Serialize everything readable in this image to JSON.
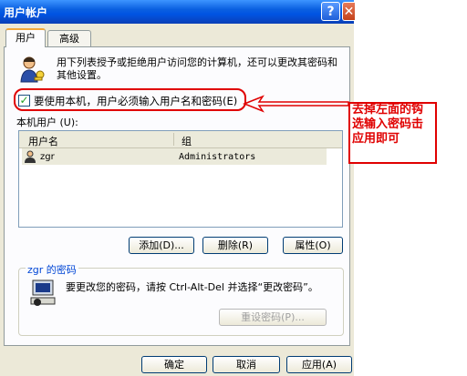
{
  "window": {
    "title": "用户帐户",
    "help_glyph": "?",
    "close_glyph": "✕"
  },
  "tabs": [
    {
      "label": "用户"
    },
    {
      "label": "高级"
    }
  ],
  "intro_text": "用下列表授予或拒绝用户访问您的计算机，还可以更改其密码和其他设置。",
  "require_checkbox": {
    "checked": true,
    "label": "要使用本机，用户必须输入用户名和密码(E)"
  },
  "local_users_label": "本机用户 (U):",
  "user_list": {
    "columns": [
      "用户名",
      "组"
    ],
    "rows": [
      {
        "name": "zgr",
        "group": "Administrators"
      }
    ]
  },
  "list_buttons": {
    "add": "添加(D)...",
    "remove": "删除(R)",
    "properties": "属性(O)"
  },
  "password_group": {
    "label": "zgr 的密码",
    "text": "要更改您的密码，请按 Ctrl-Alt-Del 并选择“更改密码”。",
    "reset_button": "重设密码(P)..."
  },
  "dialog_buttons": {
    "ok": "确定",
    "cancel": "取消",
    "apply": "应用(A)"
  },
  "annotation": {
    "text": "去掉左面的钩选输入密码击应用即可",
    "color": "#e00000"
  }
}
